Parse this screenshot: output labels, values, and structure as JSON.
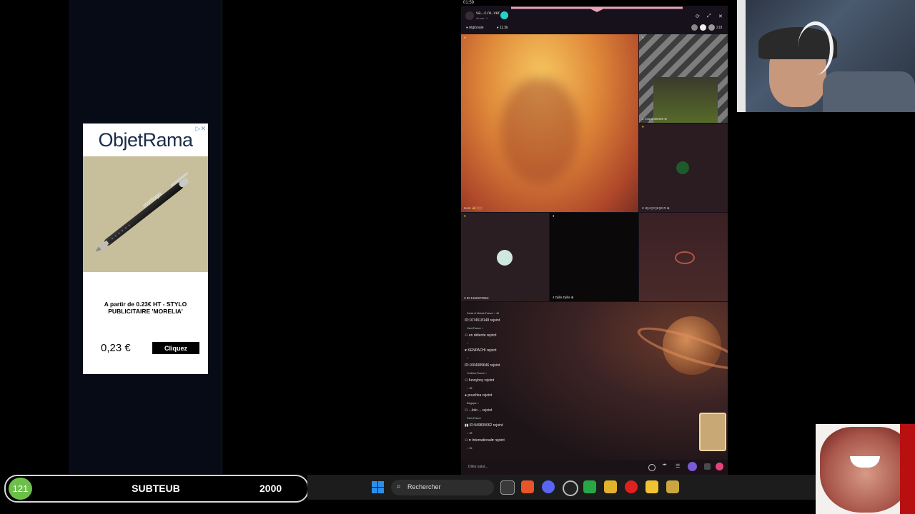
{
  "ad": {
    "brand": "ObjetRama",
    "adchoice": "▷✕",
    "pen_text": "monlogo",
    "description": "A partir de 0.23€ HT - STYLO PUBLICITAIRE 'MORELIA'",
    "price": "0,23 €",
    "cta": "Cliquez"
  },
  "status_bar": {
    "time": "01:59"
  },
  "call": {
    "host_name": "va...c.re..ver",
    "host_sub": "4h.am...f",
    "region_tag": "♦ régionale",
    "pct_tag": "♦ 11.5k",
    "viewer_count": "218",
    "tiles": [
      {
        "label": "Host ✨░░░",
        "flag": "♦"
      },
      {
        "label": "1  rospon86496 ⊕",
        "flag": "♦"
      },
      {
        "label": "2  H▯A▯C▯K▯E   R ⊕",
        "flag": "♦"
      },
      {
        "label": "3  ID:1366870853",
        "flag": "♦"
      },
      {
        "label": "4  Djilla Djilla ⊕",
        "flag": "♦"
      },
      {
        "label": "",
        "flag": ""
      }
    ]
  },
  "chat": {
    "lines": [
      {
        "text": "Genie et Mamie,France ♂ 46",
        "sub": true
      },
      {
        "text": "ID:1074518148 rejoint",
        "sub": false
      },
      {
        "text": "Gard,France ♂",
        "sub": true
      },
      {
        "text": "⚇ en détente rejoint",
        "sub": false
      },
      {
        "text": "♂",
        "sub": true
      },
      {
        "text": "♥ KENPACHI rejoint",
        "sub": false
      },
      {
        "text": "♂",
        "sub": true
      },
      {
        "text": "ID:1064089646 rejoint",
        "sub": false
      },
      {
        "text": "Yvelines,France ♂",
        "sub": true
      },
      {
        "text": "⚇ funnyboy rejoint",
        "sub": false
      },
      {
        "text": "♂ 36",
        "sub": true
      },
      {
        "text": "● pouchka rejoint",
        "sub": false
      },
      {
        "text": "Belgique ♂",
        "sub": true
      },
      {
        "text": "⚇ ...lolo ... rejoint",
        "sub": false
      },
      {
        "text": "Paris,France",
        "sub": true
      },
      {
        "text": "▮▮ ID:949839062 rejoint",
        "sub": false
      },
      {
        "text": "♂ 28",
        "sub": true
      },
      {
        "text": "⚇ ♥ International♥ rejoint",
        "sub": false
      },
      {
        "text": "♂ 26",
        "sub": true
      }
    ],
    "input_placeholder": "Dites salut..."
  },
  "goal": {
    "count": "121",
    "name": "SUBTEUB",
    "target": "2000"
  },
  "taskbar": {
    "search_label": "Rechercher",
    "icons": [
      "windows-icon",
      "task-view-icon",
      "brave-browser-icon",
      "discord-icon",
      "obs-icon",
      "spreadsheet-icon",
      "game-icon",
      "youtube-icon",
      "file-explorer-icon",
      "app-icon"
    ]
  },
  "colors": {
    "goal_green": "#6cc04a",
    "follow_teal": "#27d1c6",
    "windows_blue": "#2b8fe8"
  }
}
